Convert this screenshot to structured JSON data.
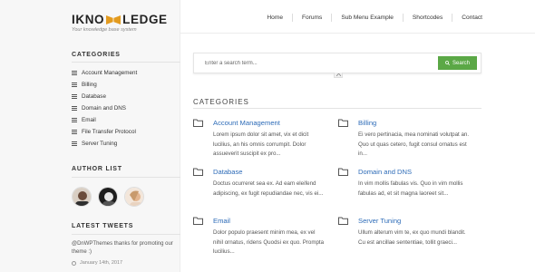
{
  "logo": {
    "part1": "IKNO",
    "part2": "LEDGE",
    "tagline": "Your knowledge base system"
  },
  "nav": [
    "Home",
    "Forums",
    "Sub Menu Example",
    "Shortcodes",
    "Contact"
  ],
  "sidebar": {
    "categories_title": "CATEGORIES",
    "categories": [
      "Account Management",
      "Billing",
      "Database",
      "Domain and DNS",
      "Email",
      "File Transfer Protocol",
      "Server Tuning"
    ],
    "authors_title": "AUTHOR LIST",
    "tweets_title": "LATEST TWEETS",
    "tweet_text": "@DnWPThemes thanks for promoting our theme :)",
    "tweet_date": "January 14th, 2017"
  },
  "search": {
    "placeholder": "Enter a search term...",
    "button_label": "Search"
  },
  "main": {
    "title": "CATEGORIES",
    "cards": [
      {
        "title": "Account Management",
        "text": "Lorem ipsum dolor sit amet, vix et dicit lucilius, an his omnis corrumpit. Dolor assueverit suscipit ex pro..."
      },
      {
        "title": "Billing",
        "text": "Ei vero pertinacia, mea nominati volutpat an. Quo ut quas cetero, fugit consul ornatus est in..."
      },
      {
        "title": "Database",
        "text": "Doctus ocurreret sea ex. Ad eam eleifend adipiscing, ex fugit repudiandae nec, vis ei..."
      },
      {
        "title": "Domain and DNS",
        "text": "In vim mollis fabulas vis. Quo in vim mollis fabulas ad, et sit magna laoreet sit..."
      },
      {
        "title": "Email",
        "text": "Dolor populo praesent minim mea, ex vel nihil ornatus, ridens Quodsi ex quo. Prompta lucilius..."
      },
      {
        "title": "Server Tuning",
        "text": "Ullum alterum vim te, ex quo mundi blandit. Cu est ancillae sententiae, tollit graeci..."
      }
    ]
  },
  "colors": {
    "accent_green": "#5ba846",
    "link_blue": "#2e6cb8",
    "logo_gold": "#e39b1f"
  }
}
